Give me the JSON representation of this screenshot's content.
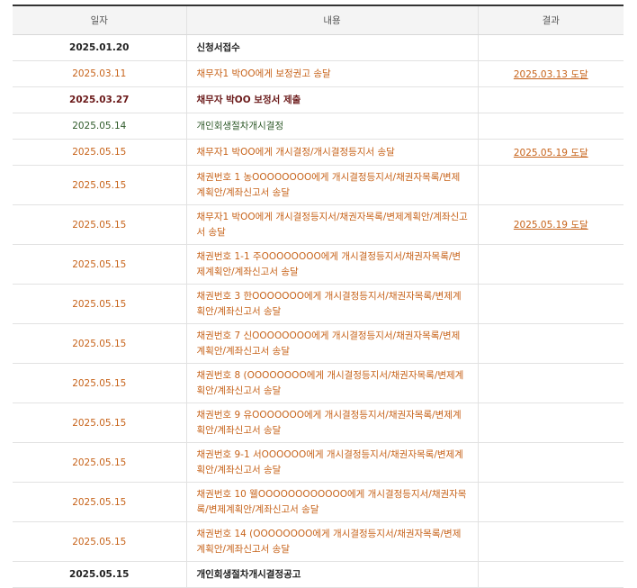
{
  "table": {
    "headers": {
      "date": "일자",
      "content": "내용",
      "result": "결과"
    },
    "rows": [
      {
        "date": "2025.01.20",
        "content": "신청서접수",
        "result": "",
        "style": "c-black",
        "single": true
      },
      {
        "date": "2025.03.11",
        "content": "채무자1 박OO에게 보정권고 송달",
        "result": "2025.03.13 도달",
        "style": "c-orange",
        "single": true
      },
      {
        "date": "2025.03.27",
        "content": "채무자 박OO 보정서 제출",
        "result": "",
        "style": "c-maroon",
        "single": true
      },
      {
        "date": "2025.05.14",
        "content": "개인회생절차개시결정",
        "result": "",
        "style": "c-green",
        "single": true
      },
      {
        "date": "2025.05.15",
        "content": "채무자1 박OO에게 개시결정/개시결정등지서 송달",
        "result": "2025.05.19 도달",
        "style": "c-orange",
        "single": true
      },
      {
        "date": "2025.05.15",
        "content": "채권번호 1 농OOOOOOOO에게 개시결정등지서/채권자목록/변제계획안/계좌신고서 송달",
        "result": "",
        "style": "c-orange",
        "single": false
      },
      {
        "date": "2025.05.15",
        "content": "채무자1 박OO에게 개시결정등지서/채권자목록/변제계획안/계좌신고서 송달",
        "result": "2025.05.19 도달",
        "style": "c-orange",
        "single": false
      },
      {
        "date": "2025.05.15",
        "content": "채권번호 1-1 주OOOOOOOO에게 개시결정등지서/채권자목록/변제계획안/계좌신고서 송달",
        "result": "",
        "style": "c-orange",
        "single": false
      },
      {
        "date": "2025.05.15",
        "content": "채권번호 3 한OOOOOOO에게 개시결정등지서/채권자목록/변제계획안/계좌신고서 송달",
        "result": "",
        "style": "c-orange",
        "single": false
      },
      {
        "date": "2025.05.15",
        "content": "채권번호 7 신OOOOOOOO에게 개시결정등지서/채권자목록/변제계획안/계좌신고서 송달",
        "result": "",
        "style": "c-orange",
        "single": false
      },
      {
        "date": "2025.05.15",
        "content": "채권번호 8 (OOOOOOOO에게 개시결정등지서/채권자목록/변제계획안/계좌신고서 송달",
        "result": "",
        "style": "c-orange",
        "single": false
      },
      {
        "date": "2025.05.15",
        "content": "채권번호 9 유OOOOOOO에게 개시결정등지서/채권자목록/변제계획안/계좌신고서 송달",
        "result": "",
        "style": "c-orange",
        "single": false
      },
      {
        "date": "2025.05.15",
        "content": "채권번호 9-1 서OOOOOO에게 개시결정등지서/채권자목록/변제계획안/계좌신고서 송달",
        "result": "",
        "style": "c-orange",
        "single": false
      },
      {
        "date": "2025.05.15",
        "content": "채권번호 10 웰OOOOOOOOOOOO에게 개시결정등지서/채권자목록/변제계획안/계좌신고서 송달",
        "result": "",
        "style": "c-orange",
        "single": false
      },
      {
        "date": "2025.05.15",
        "content": "채권번호 14 (OOOOOOOO에게 개시결정등지서/채권자목록/변제계획안/계좌신고서 송달",
        "result": "",
        "style": "c-orange",
        "single": false
      },
      {
        "date": "2025.05.15",
        "content": "개인회생절차개시결정공고",
        "result": "",
        "style": "c-black",
        "single": true
      }
    ]
  }
}
